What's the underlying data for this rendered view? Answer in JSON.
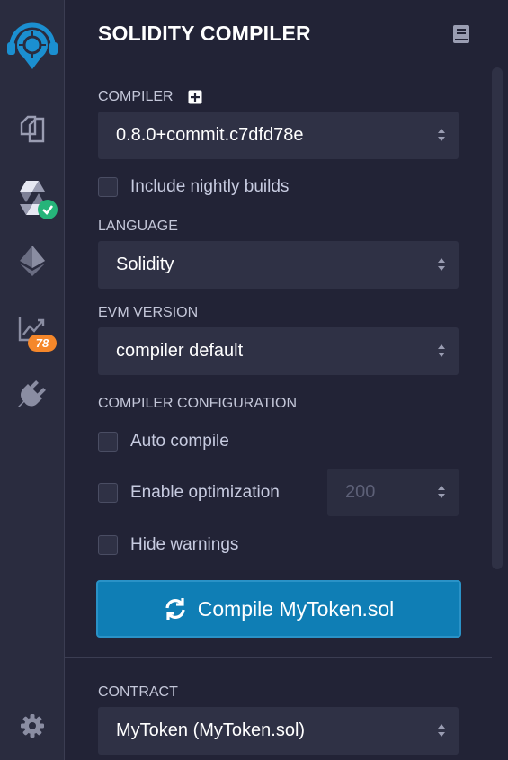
{
  "panel": {
    "title": "SOLIDITY COMPILER"
  },
  "sidebar": {
    "analysis_badge": "78"
  },
  "compiler": {
    "label": "COMPILER",
    "version": "0.8.0+commit.c7dfd78e",
    "nightly_label": "Include nightly builds",
    "nightly_checked": false
  },
  "language": {
    "label": "LANGUAGE",
    "value": "Solidity"
  },
  "evm": {
    "label": "EVM VERSION",
    "value": "compiler default"
  },
  "config": {
    "label": "COMPILER CONFIGURATION",
    "auto_compile_label": "Auto compile",
    "auto_compile_checked": false,
    "optimization_label": "Enable optimization",
    "optimization_checked": false,
    "runs_value": "200",
    "hide_warnings_label": "Hide warnings",
    "hide_warnings_checked": false
  },
  "compile_button": {
    "label": "Compile MyToken.sol"
  },
  "contract": {
    "label": "CONTRACT",
    "value": "MyToken (MyToken.sol)"
  },
  "colors": {
    "accent": "#0f7eb5",
    "success": "#26b47a",
    "badge": "#f5872a",
    "background": "#222336",
    "sidebar": "#2a2c3f"
  }
}
